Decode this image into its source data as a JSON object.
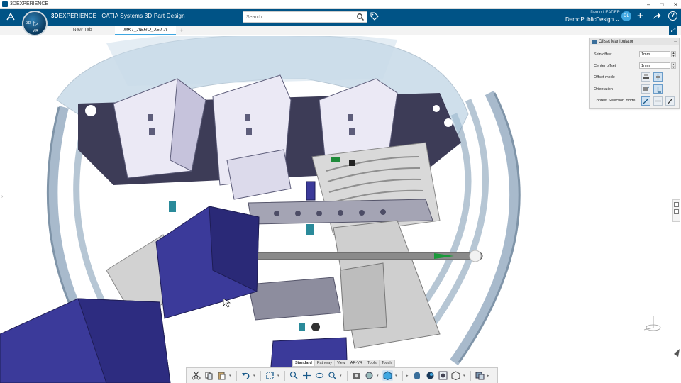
{
  "window": {
    "title": "3DEXPERIENCE",
    "minimize": "–",
    "maximize": "□",
    "close": "✕"
  },
  "header": {
    "brand_bold": "3D",
    "brand_rest": "EXPERIENCE | CATIA Systems 3D Part Design",
    "search_placeholder": "Search",
    "user_name": "Demo LEADER",
    "collab_space": "DemoPublicDesign",
    "avatar_initials": "DL",
    "help": "?"
  },
  "compass": {
    "label_3d": "3D",
    "version": "V.R"
  },
  "tabs": [
    {
      "label": "New Tab",
      "active": false
    },
    {
      "label": "MKT_AERO_JET A",
      "active": true
    }
  ],
  "tab_add": "+",
  "panel": {
    "title": "Offset Manipulator",
    "close": "–",
    "skin_offset_label": "Skin offset",
    "skin_offset_value": "1mm",
    "center_offset_label": "Center offset",
    "center_offset_value": "1mm",
    "offset_mode_label": "Offset mode",
    "orientation_label": "Orientation",
    "context_selection_label": "Context Selection mode"
  },
  "action_tabs": [
    {
      "label": "Standard",
      "active": true
    },
    {
      "label": "Pathway",
      "active": false
    },
    {
      "label": "View",
      "active": false
    },
    {
      "label": "AR-VR",
      "active": false
    },
    {
      "label": "Tools",
      "active": false
    },
    {
      "label": "Touch",
      "active": false
    }
  ],
  "action_icons": [
    "cut-icon",
    "copy-icon",
    "paste-icon",
    "undo-icon",
    "update-icon",
    "zoom-area-icon",
    "pan-icon",
    "rotate-icon",
    "zoom-icon",
    "capture-icon",
    "normal-view-icon",
    "cube-view-icon",
    "display-mode-icon",
    "visualization-icon",
    "render-icon",
    "section-icon",
    "hide-show-icon",
    "more-icon"
  ],
  "colors": {
    "header_bg": "#005386",
    "accent": "#3fa7e1",
    "body_blue": "#3b3a9a",
    "hull": "#a8c6dc"
  }
}
